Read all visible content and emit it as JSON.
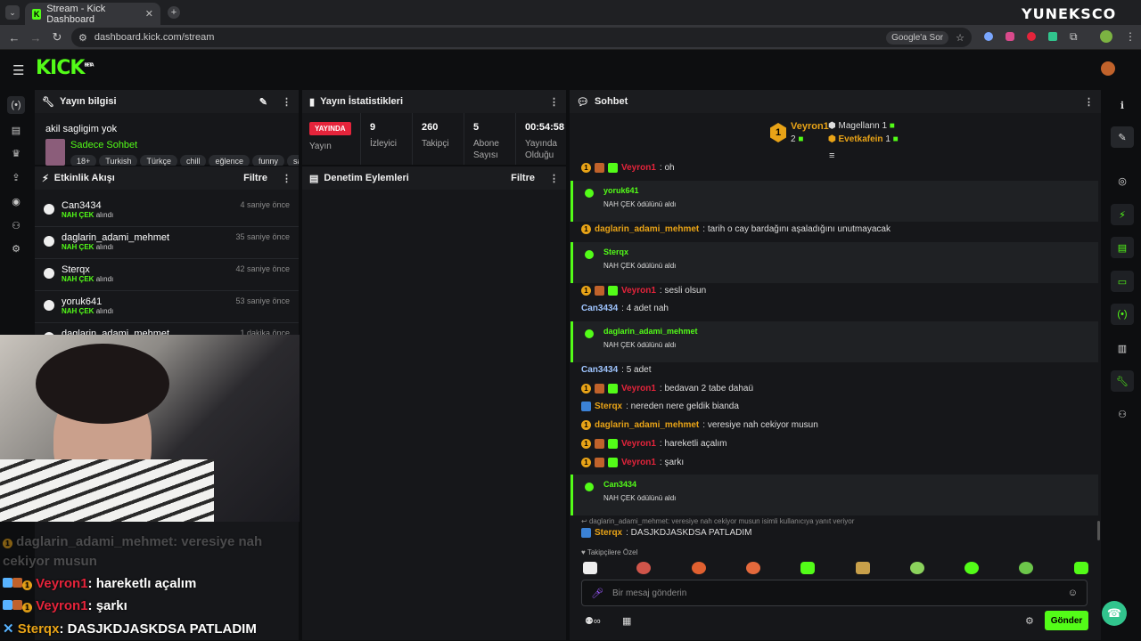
{
  "browser": {
    "tab_title": "Stream - Kick Dashboard",
    "url": "dashboard.kick.com/stream",
    "ask_google": "Google'a Sor",
    "watermark": "YUNEKSCO"
  },
  "app": {
    "logo": "KICK",
    "logo_sup": "BETA"
  },
  "left_sidebar_icons": [
    "broadcast-icon",
    "library-icon",
    "trophy-icon",
    "upload-icon",
    "camera-icon",
    "users-icon",
    "gear-icon"
  ],
  "right_sidebar_icons": [
    "info-icon",
    "pen-icon",
    "clip-icon",
    "lightning-icon",
    "notes-icon",
    "chat-icon",
    "broadcast-icon",
    "layout-icon",
    "wrench-icon",
    "users-icon"
  ],
  "stream_info": {
    "title": "Yayın bilgisi",
    "stream_title": "akil sagligim yok",
    "category": "Sadece Sohbet",
    "tags": [
      "18+",
      "Turkish",
      "Türkçe",
      "chill",
      "eğlence",
      "funny",
      "sa"
    ]
  },
  "stats": {
    "title": "Yayın İstatistikleri",
    "live_badge": "YAYINDA",
    "live_label": "Yayın",
    "items": [
      {
        "value": "9",
        "label": "İzleyici"
      },
      {
        "value": "260",
        "label": "Takipçi"
      },
      {
        "value": "5",
        "label": "Abone Sayısı"
      },
      {
        "value": "00:54:58",
        "label": "Yayında Olduğu"
      }
    ]
  },
  "activity": {
    "title": "Etkinlik Akışı",
    "filter": "Filtre",
    "events": [
      {
        "name": "Can3434",
        "reward": "NAH ÇEK",
        "suffix": "alındı",
        "time": "4 saniye önce"
      },
      {
        "name": "daglarin_adami_mehmet",
        "reward": "NAH ÇEK",
        "suffix": "alındı",
        "time": "35 saniye önce"
      },
      {
        "name": "Sterqx",
        "reward": "NAH ÇEK",
        "suffix": "alındı",
        "time": "42 saniye önce"
      },
      {
        "name": "yoruk641",
        "reward": "NAH ÇEK",
        "suffix": "alındı",
        "time": "53 saniye önce"
      },
      {
        "name": "daglarin_adami_mehmet",
        "reward": "",
        "suffix": "",
        "time": "1 dakika önce"
      }
    ]
  },
  "moderation": {
    "title": "Denetim Eylemleri",
    "filter": "Filtre"
  },
  "chat": {
    "title": "Sohbet",
    "top_gifter": {
      "rank": "1",
      "name": "Veyron1",
      "count": "2"
    },
    "gifters": [
      {
        "name": "Magellann",
        "count": "1"
      },
      {
        "name": "Evetkafein",
        "count": "1"
      }
    ],
    "messages": [
      {
        "user": "Veyron1",
        "text": ": oh"
      },
      {
        "user": "yoruk641",
        "text": "NAH ÇEK ödülünü aldı",
        "reward": true
      },
      {
        "user": "daglarin_adami_mehmet",
        "text": ": tarih o cay bardağını aşaladığını unutmayacak"
      },
      {
        "user": "Sterqx",
        "text": "NAH ÇEK ödülünü aldı",
        "reward": true
      },
      {
        "user": "Veyron1",
        "text": ": sesli olsun"
      },
      {
        "user": "Can3434",
        "text": ": 4 adet nah"
      },
      {
        "user": "daglarin_adami_mehmet",
        "text": "NAH ÇEK ödülünü aldı",
        "reward": true
      },
      {
        "user": "Can3434",
        "text": ": 5 adet"
      },
      {
        "user": "Veyron1",
        "text": ": bedavan 2 tabe dahaü"
      },
      {
        "user": "Sterqx",
        "text": ": nereden nere geldik bianda"
      },
      {
        "user": "daglarin_adami_mehmet",
        "text": ": veresiye nah cekiyor musun"
      },
      {
        "user": "Veyron1",
        "text": ": hareketli açalım"
      },
      {
        "user": "Veyron1",
        "text": ": şarkı"
      },
      {
        "user": "Can3434",
        "text": "NAH ÇEK ödülünü aldı",
        "reward": true
      }
    ],
    "reply_context": "daglarin_adami_mehmet: veresiye nah cekiyor musun isimli kullanıcıya yanıt veriyor",
    "reply_user": "Sterqx",
    "reply_text": ": DASJKDJASKDSA PATLADIM",
    "followers_only": "Takipçilere Özel",
    "input_placeholder": "Bir mesaj gönderin",
    "send": "Gönder"
  },
  "overlay_chat": [
    {
      "user": "daglarin_adami_mehmet",
      "text": ": veresiye nah cekiyor musun"
    },
    {
      "user": "Veyron1",
      "text": ": hareketlı açalım"
    },
    {
      "user": "Veyron1",
      "text": ": şarkı"
    },
    {
      "user": "Sterqx",
      "text": ": DASJKDJASKDSA PATLADIM"
    }
  ],
  "colors": {
    "brand": "#53fc18",
    "red": "#e5243b",
    "gold": "#e8a317"
  }
}
